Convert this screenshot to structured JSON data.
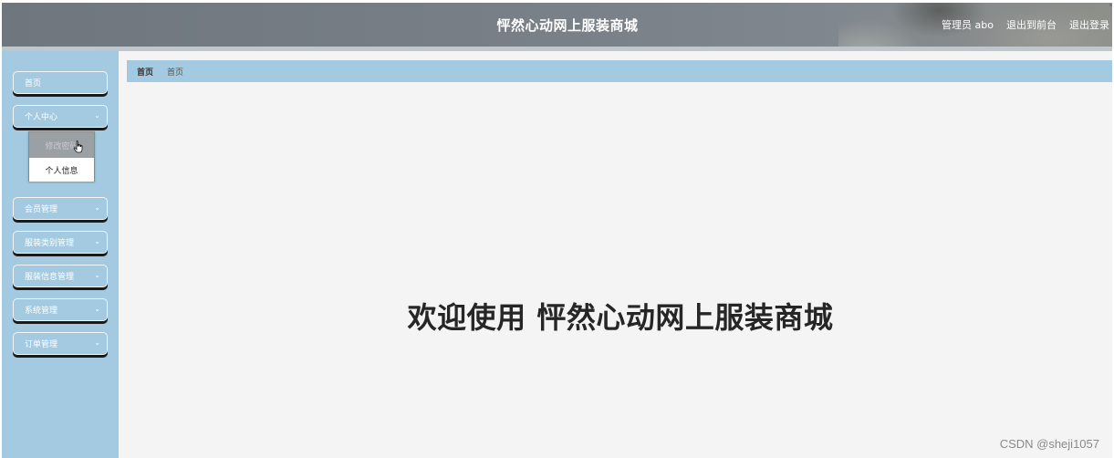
{
  "header": {
    "title": "怦然心动网上服装商城",
    "links": [
      "管理员 abo",
      "退出到前台",
      "退出登录"
    ]
  },
  "sidebar": {
    "items": [
      {
        "label": "首页",
        "has_chevron": false
      },
      {
        "label": "个人中心",
        "has_chevron": true
      },
      {
        "label": "会员管理",
        "has_chevron": true
      },
      {
        "label": "服装类别管理",
        "has_chevron": true
      },
      {
        "label": "服装信息管理",
        "has_chevron": true
      },
      {
        "label": "系统管理",
        "has_chevron": true
      },
      {
        "label": "订单管理",
        "has_chevron": true
      }
    ],
    "submenu": [
      "修改密码",
      "个人信息"
    ],
    "chevron": "⌄"
  },
  "breadcrumb": [
    "首页",
    "首页"
  ],
  "welcome": "欢迎使用 怦然心动网上服装商城",
  "watermark": "CSDN @sheji1057",
  "colors": {
    "header": "#777e85",
    "sidebar": "#a3cae0",
    "content": "#f4f4f4",
    "text_dark": "#262626"
  }
}
